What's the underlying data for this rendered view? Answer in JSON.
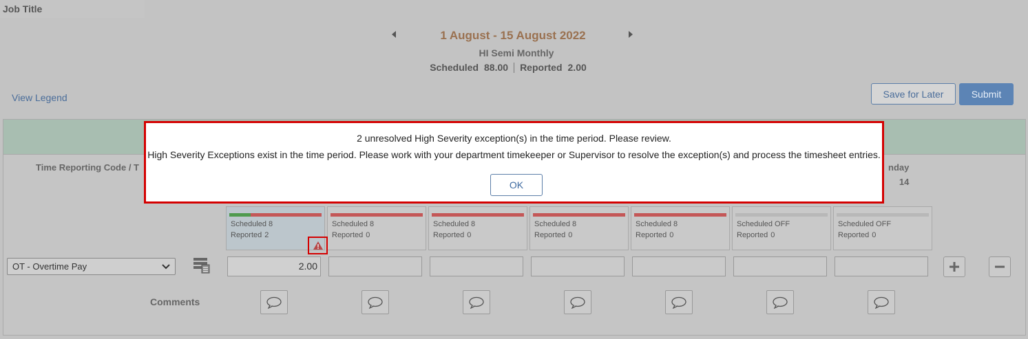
{
  "header": {
    "job_title_label": "Job Title",
    "period": "1 August - 15 August 2022",
    "pay_group": "HI Semi Monthly",
    "scheduled_label": "Scheduled",
    "scheduled_value": "88.00",
    "reported_label": "Reported",
    "reported_value": "2.00"
  },
  "actions": {
    "view_legend": "View Legend",
    "save_for_later": "Save for Later",
    "submit": "Submit"
  },
  "grid": {
    "trc_header": "Time Reporting Code / T",
    "last_day_header": "nday",
    "last_day_date": "14",
    "trc_selected": "OT - Overtime Pay",
    "comments_label": "Comments",
    "days": [
      {
        "scheduled": "Scheduled 8",
        "reported_label": "Reported",
        "reported": "2",
        "hours": "2.00",
        "progress": 0.23
      },
      {
        "scheduled": "Scheduled 8",
        "reported_label": "Reported",
        "reported": "0",
        "hours": "",
        "progress": 0
      },
      {
        "scheduled": "Scheduled 8",
        "reported_label": "Reported",
        "reported": "0",
        "hours": "",
        "progress": 0
      },
      {
        "scheduled": "Scheduled 8",
        "reported_label": "Reported",
        "reported": "0",
        "hours": "",
        "progress": 0
      },
      {
        "scheduled": "Scheduled 8",
        "reported_label": "Reported",
        "reported": "0",
        "hours": "",
        "progress": 0
      },
      {
        "scheduled": "Scheduled OFF",
        "reported_label": "Reported",
        "reported": "0",
        "hours": "",
        "progress": 0
      },
      {
        "scheduled": "Scheduled OFF",
        "reported_label": "Reported",
        "reported": "0",
        "hours": "",
        "progress": 0
      }
    ]
  },
  "modal": {
    "message_1": "2 unresolved High Severity exception(s) in the time period. Please review.",
    "message_2": "High Severity Exceptions exist in the time period. Please work with your department timekeeper or Supervisor to resolve the exception(s) and process the timesheet entries.",
    "ok_label": "OK"
  },
  "colors": {
    "alert_border": "#d40000",
    "progress_reported": "#4e9a4e",
    "progress_unreported": "#c45757",
    "primary_button": "#5c84b5"
  },
  "icons": {
    "prev": "chevron-left-icon",
    "next": "chevron-right-icon",
    "warning": "warning-icon",
    "dropdown": "chevron-down-icon",
    "task": "task-list-icon",
    "add": "plus-icon",
    "remove": "minus-icon",
    "comment": "comment-bubble-icon"
  }
}
